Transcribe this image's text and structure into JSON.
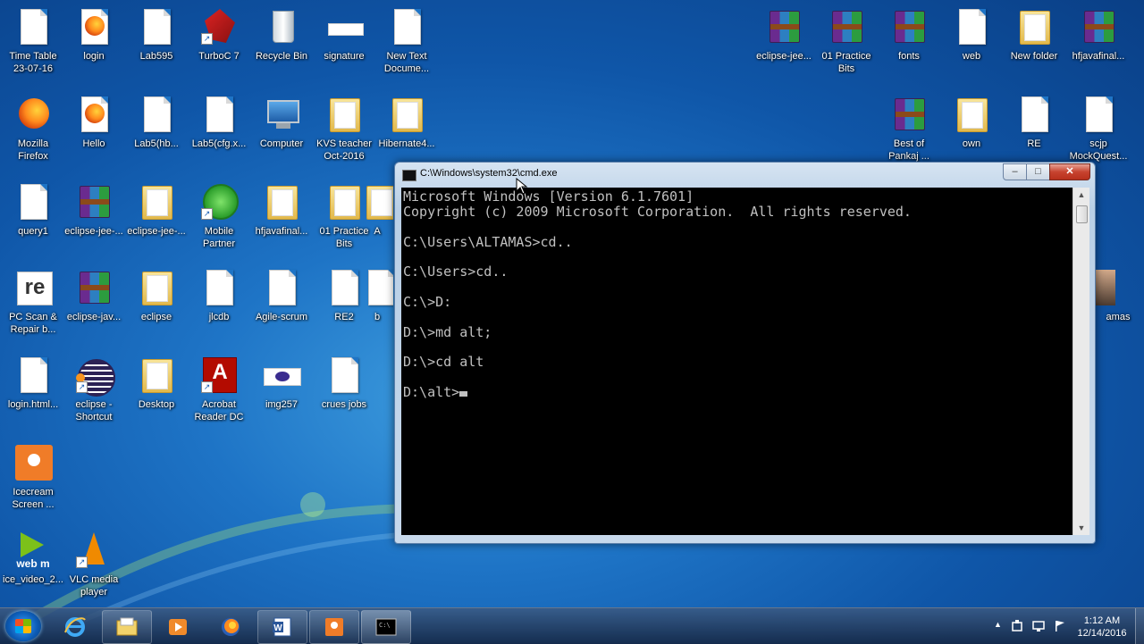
{
  "desktop": {
    "icons": [
      {
        "label": "Time Table\n23-07-16",
        "icon": "document-icon"
      },
      {
        "label": "login",
        "icon": "firefox-html-icon"
      },
      {
        "label": "Lab595",
        "icon": "document-icon"
      },
      {
        "label": "TurboC 7",
        "icon": "turboc-icon"
      },
      {
        "label": "Recycle Bin",
        "icon": "recycle-bin-icon"
      },
      {
        "label": "signature",
        "icon": "image-icon"
      },
      {
        "label": "New Text\nDocume...",
        "icon": "document-icon"
      },
      {
        "label": "Mozilla\nFirefox",
        "icon": "firefox-icon"
      },
      {
        "label": "Hello",
        "icon": "firefox-html-icon"
      },
      {
        "label": "Lab5(hb...",
        "icon": "document-icon"
      },
      {
        "label": "Lab5(cfg.x...",
        "icon": "document-icon"
      },
      {
        "label": "Computer",
        "icon": "computer-icon"
      },
      {
        "label": "KVS teacher\nOct-2016",
        "icon": "folder-icon"
      },
      {
        "label": "Hibernate4...",
        "icon": "folder-icon"
      },
      {
        "label": "query1",
        "icon": "document-icon"
      },
      {
        "label": "eclipse-jee-...",
        "icon": "winrar-icon"
      },
      {
        "label": "eclipse-jee-...",
        "icon": "folder-icon"
      },
      {
        "label": "Mobile\nPartner",
        "icon": "mobile-partner-icon"
      },
      {
        "label": "hfjavafinal...",
        "icon": "folder-icon"
      },
      {
        "label": "01 Practice\nBits",
        "icon": "folder-icon"
      },
      {
        "label": "A",
        "icon": "folder-icon"
      },
      {
        "label": "PC Scan &\nRepair b...",
        "icon": "reimage-icon"
      },
      {
        "label": "eclipse-jav...",
        "icon": "winrar-icon"
      },
      {
        "label": "eclipse",
        "icon": "folder-icon"
      },
      {
        "label": "jlcdb",
        "icon": "document-icon"
      },
      {
        "label": "Agile-scrum",
        "icon": "document-icon"
      },
      {
        "label": "RE2",
        "icon": "document-icon"
      },
      {
        "label": "b",
        "icon": "document-icon"
      },
      {
        "label": "login.html...",
        "icon": "document-icon"
      },
      {
        "label": "eclipse -\nShortcut",
        "icon": "eclipse-icon"
      },
      {
        "label": "Desktop",
        "icon": "folder-icon"
      },
      {
        "label": "Acrobat\nReader DC",
        "icon": "acrobat-icon"
      },
      {
        "label": "img257",
        "icon": "image-icon"
      },
      {
        "label": "crues jobs",
        "icon": "document-icon"
      },
      {
        "label": "Icecream\nScreen ...",
        "icon": "icecream-icon"
      },
      {
        "label": "ice_video_2...",
        "icon": "webm-icon",
        "overlay": "web m"
      },
      {
        "label": "VLC media\nplayer",
        "icon": "vlc-icon"
      },
      {
        "label": "eclipse-jee...",
        "icon": "winrar-icon"
      },
      {
        "label": "01 Practice\nBits",
        "icon": "winrar-icon"
      },
      {
        "label": "fonts",
        "icon": "winrar-icon"
      },
      {
        "label": "web",
        "icon": "web-document-icon"
      },
      {
        "label": "New folder",
        "icon": "folder-icon"
      },
      {
        "label": "hfjavafinal...",
        "icon": "winrar-icon"
      },
      {
        "label": "Best of\nPankaj ...",
        "icon": "winrar-icon"
      },
      {
        "label": "own",
        "icon": "folder-icon"
      },
      {
        "label": "RE",
        "icon": "document-icon"
      },
      {
        "label": "scjp\nMockQuest...",
        "icon": "document-icon"
      },
      {
        "label": "amas",
        "icon": "photo-icon"
      }
    ]
  },
  "cmd_window": {
    "title": "C:\\Windows\\system32\\cmd.exe",
    "minimize_glyph": "–",
    "maximize_glyph": "□",
    "close_glyph": "✕",
    "console_text": "Microsoft Windows [Version 6.1.7601]\nCopyright (c) 2009 Microsoft Corporation.  All rights reserved.\n\nC:\\Users\\ALTAMAS>cd..\n\nC:\\Users>cd..\n\nC:\\>D:\n\nD:\\>md alt;\n\nD:\\>cd alt\n\nD:\\alt>",
    "scroll_up": "▲",
    "scroll_down": "▼"
  },
  "taskbar": {
    "start_icon": "windows-start-icon",
    "pinned": [
      {
        "name": "internet-explorer-icon"
      },
      {
        "name": "file-explorer-icon"
      },
      {
        "name": "media-player-icon"
      },
      {
        "name": "firefox-icon"
      },
      {
        "name": "word-icon"
      },
      {
        "name": "icecream-recorder-icon"
      },
      {
        "name": "cmd-icon"
      }
    ],
    "tray_expand": "▲",
    "clock_time": "1:12 AM",
    "clock_date": "12/14/2016"
  },
  "colors": {
    "desktop_blue": "#1e74c6",
    "console_bg": "#000000",
    "console_fg": "#c0c0c0",
    "close_red": "#c7432f"
  }
}
